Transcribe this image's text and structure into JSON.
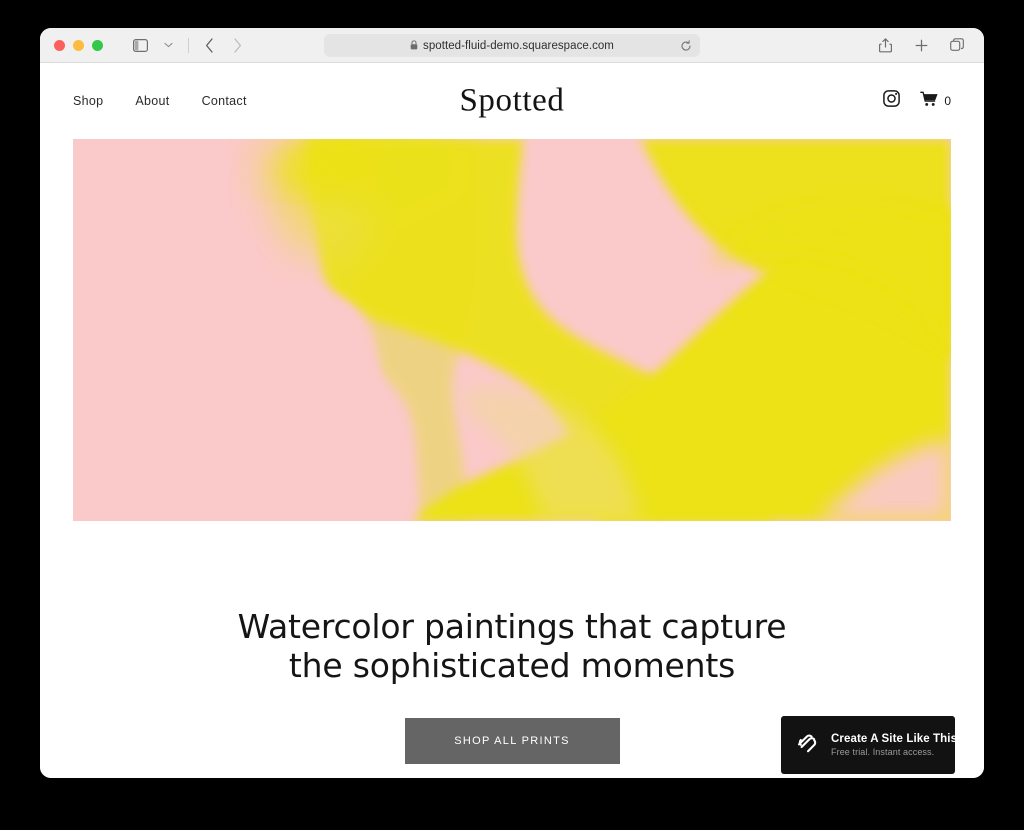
{
  "browser": {
    "traffic_lights": [
      "close",
      "minimize",
      "maximize"
    ],
    "sidebar_toggle_label": "Show Sidebar",
    "sidebar_dropdown_label": "Sidebar Options",
    "back_label": "Back",
    "forward_label": "Forward",
    "address": {
      "url": "spotted-fluid-demo.squarespace.com",
      "lock_icon": "lock-icon",
      "reload_icon": "reload-icon"
    },
    "actions": {
      "share_label": "Share",
      "new_tab_label": "New Tab",
      "tab_overview_label": "Tab Overview"
    }
  },
  "site": {
    "logo": "Spotted",
    "nav": [
      {
        "label": "Shop"
      },
      {
        "label": "About"
      },
      {
        "label": "Contact"
      }
    ],
    "header_icons": {
      "instagram_label": "Instagram",
      "cart_label": "Cart",
      "cart_count": "0"
    },
    "hero": {
      "alt": "Pink and yellow abstract watercolor painting",
      "background_color": "#fac9c9",
      "paint_color": "#ece212",
      "paint_color_soft": "#e6d94a"
    },
    "headline": {
      "line1": "Watercolor paintings that capture",
      "line2": "the sophisticated moments"
    },
    "cta": {
      "label": "SHOP ALL PRINTS",
      "background_color": "#656565"
    }
  },
  "squarespace_badge": {
    "title": "Create A Site Like This",
    "subtitle": "Free trial. Instant access.",
    "logo_label": "Squarespace",
    "background_color": "#121212"
  }
}
